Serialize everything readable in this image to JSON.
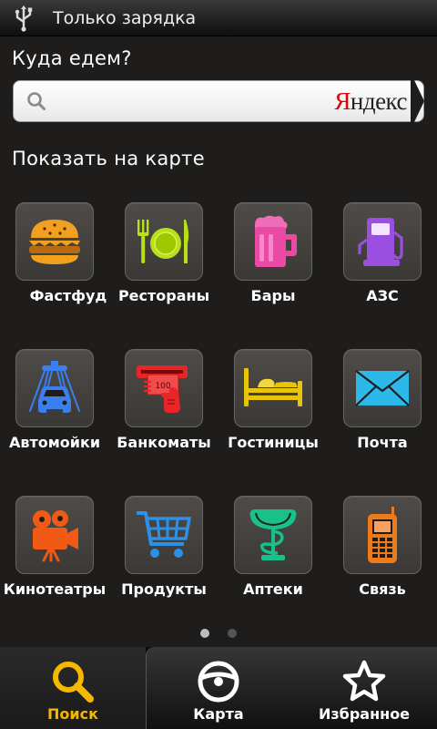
{
  "statusbar": {
    "icon": "usb-icon",
    "text": "Только зарядка"
  },
  "prompt": "Куда едем?",
  "search": {
    "value": "",
    "placeholder": "",
    "brand": "Яндекс"
  },
  "section_title": "Показать на карте",
  "categories": [
    {
      "label": "Фастфуд",
      "icon": "burger-icon"
    },
    {
      "label": "Рестораны",
      "icon": "restaurant-icon"
    },
    {
      "label": "Бары",
      "icon": "beer-mug-icon"
    },
    {
      "label": "АЗС",
      "icon": "fuel-pump-icon"
    },
    {
      "label": "Автомойки",
      "icon": "car-wash-icon"
    },
    {
      "label": "Банкоматы",
      "icon": "atm-icon"
    },
    {
      "label": "Гостиницы",
      "icon": "bed-icon"
    },
    {
      "label": "Почта",
      "icon": "envelope-icon"
    },
    {
      "label": "Кинотеатры",
      "icon": "movie-camera-icon"
    },
    {
      "label": "Продукты",
      "icon": "shopping-cart-icon"
    },
    {
      "label": "Аптеки",
      "icon": "pharmacy-icon"
    },
    {
      "label": "Связь",
      "icon": "mobile-phone-icon"
    }
  ],
  "atm_note": "100",
  "pager": {
    "pages": 2,
    "current": 1
  },
  "tabs": [
    {
      "label": "Поиск",
      "icon": "search-icon",
      "active": true
    },
    {
      "label": "Карта",
      "icon": "steering-wheel-icon",
      "active": false
    },
    {
      "label": "Избранное",
      "icon": "star-icon",
      "active": false
    }
  ],
  "colors": {
    "accent": "#f5b800",
    "background": "#1f1d1b",
    "tile": "#46433f",
    "yandex_red": "#e00000"
  }
}
